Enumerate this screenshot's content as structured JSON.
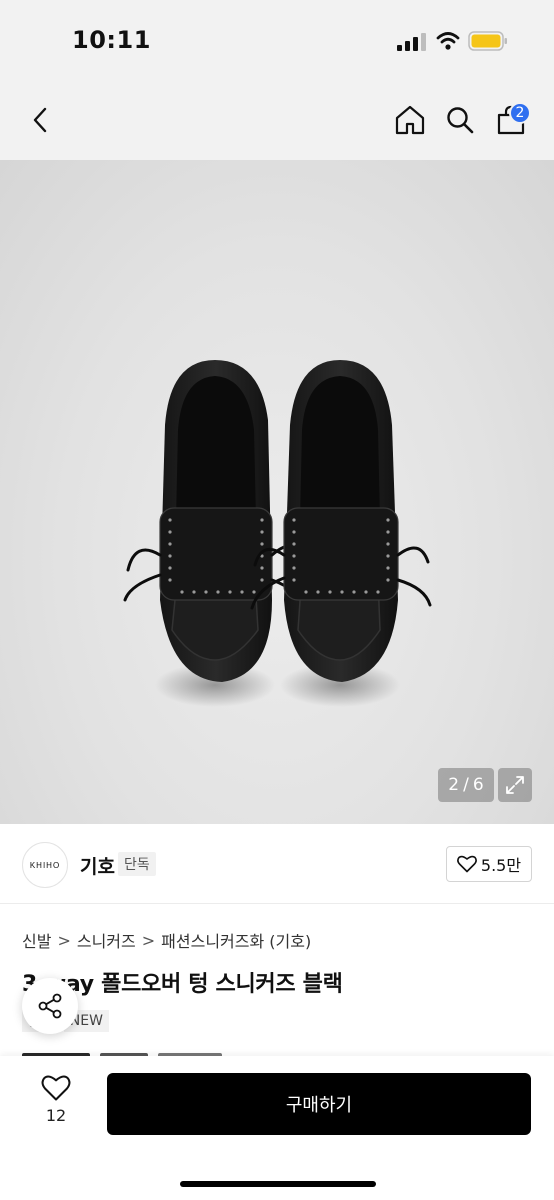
{
  "status_bar": {
    "time": "10:11"
  },
  "nav": {
    "cart_count": "2",
    "icons": [
      "chevron-left-icon",
      "home-icon",
      "search-icon",
      "bag-icon"
    ]
  },
  "gallery": {
    "current": "2",
    "separator": "/",
    "total": "6",
    "image_description_icon": "product-photo"
  },
  "brand": {
    "logo_text": "KHIHO",
    "name": "기호",
    "tag": "단독",
    "like_count": "5.5만"
  },
  "product": {
    "breadcrumb": [
      "신발",
      "스니커즈",
      "패션스니커즈화 (기호)"
    ],
    "breadcrumb_sep": ">",
    "title": "3-way 폴드오버 텅 스니커즈 블랙",
    "tags": [
      "단독",
      "NEW"
    ]
  },
  "bottom_bar": {
    "wish_count": "12",
    "buy_label": "구매하기"
  },
  "colors": {
    "accent_badge": "#2f6ff0",
    "buy_button": "#000000",
    "battery": "#f5c518"
  }
}
